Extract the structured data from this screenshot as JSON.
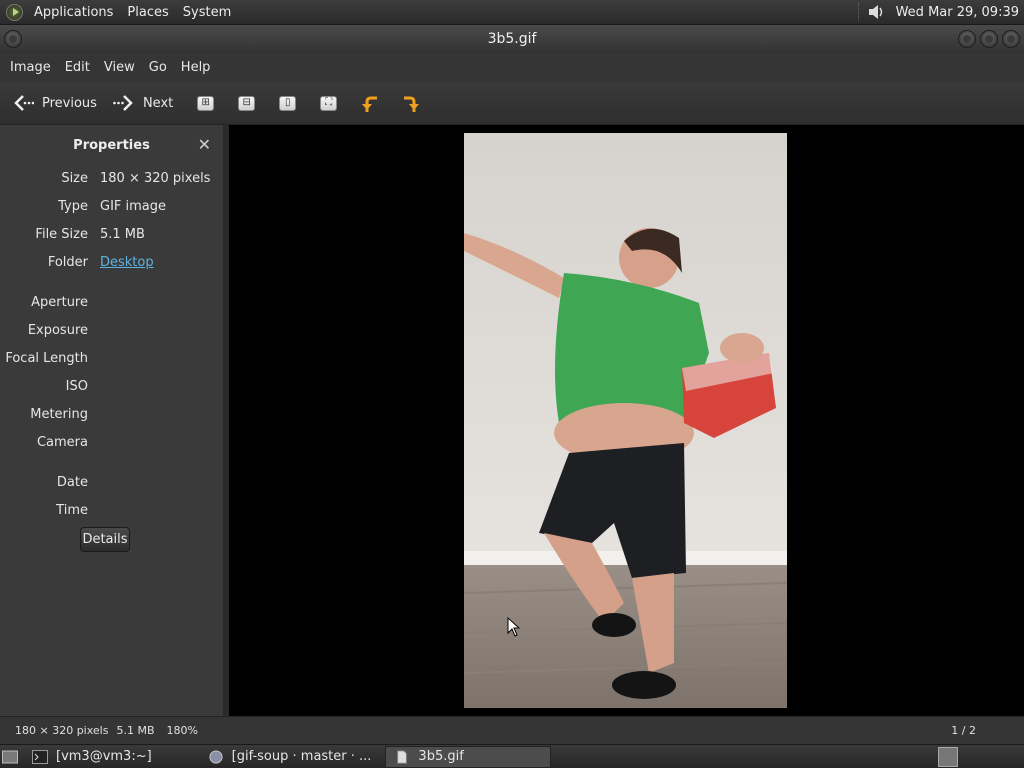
{
  "top_panel": {
    "menus": [
      "Applications",
      "Places",
      "System"
    ],
    "clock": "Wed Mar 29, 09:39"
  },
  "window": {
    "title": "3b5.gif"
  },
  "menubar": [
    "Image",
    "Edit",
    "View",
    "Go",
    "Help"
  ],
  "toolbar": {
    "previous_label": "Previous",
    "next_label": "Next",
    "icons": [
      "zoom-in-icon",
      "zoom-out-icon",
      "zoom-normal-icon",
      "zoom-fit-icon",
      "rotate-left-icon",
      "rotate-right-icon"
    ]
  },
  "properties": {
    "title": "Properties",
    "rows": [
      {
        "key": "Size",
        "value": "180 × 320 pixels"
      },
      {
        "key": "Type",
        "value": "GIF image"
      },
      {
        "key": "File Size",
        "value": "5.1 MB"
      },
      {
        "key": "Folder",
        "value": "Desktop"
      }
    ],
    "exif": [
      "Aperture",
      "Exposure",
      "Focal Length",
      "ISO",
      "Metering",
      "Camera"
    ],
    "datetime": [
      "Date",
      "Time"
    ],
    "details_label": "Details"
  },
  "statusbar": {
    "dimensions": "180 × 320 pixels",
    "filesize": "5.1 MB",
    "zoom": "180%",
    "page": "1 / 2"
  },
  "taskbar": {
    "tasks": [
      "[vm3@vm3:~]",
      "[gif-soup · master · ...",
      "3b5.gif"
    ]
  },
  "colors": {
    "accent_link": "#5fb3e0",
    "rotate_arrow": "#f0a020"
  }
}
